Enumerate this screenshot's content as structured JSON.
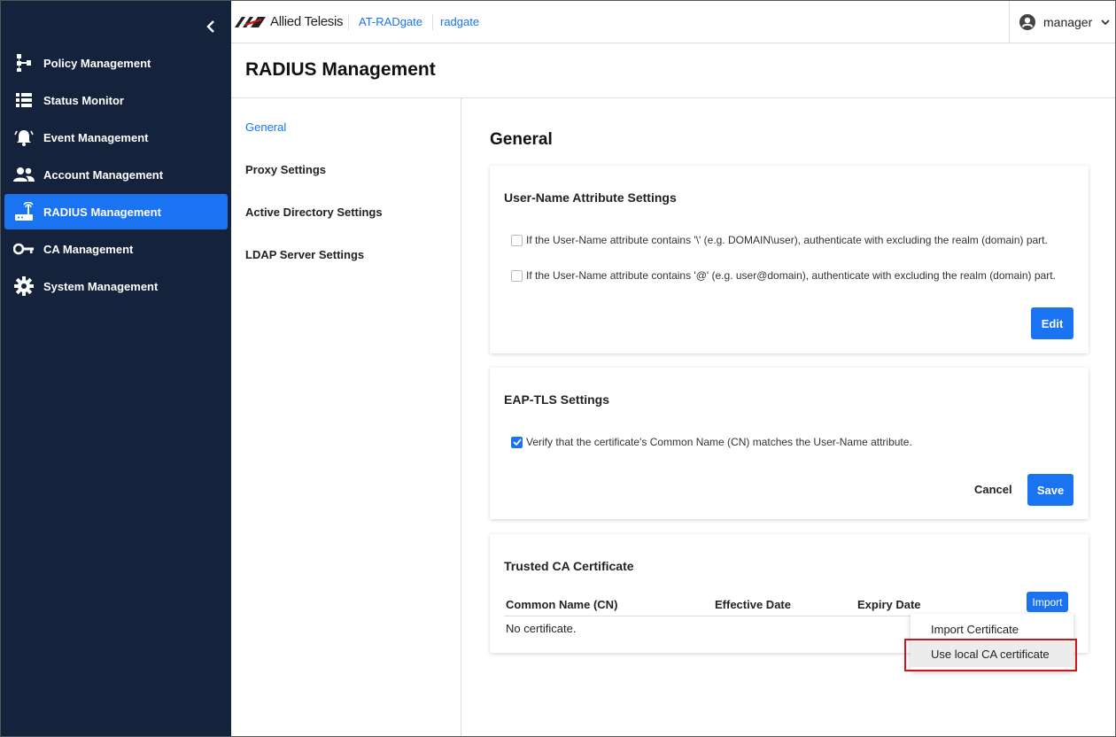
{
  "brand": {
    "name": "Allied Telesis"
  },
  "breadcrumb": [
    "AT-RADgate",
    "radgate"
  ],
  "user": {
    "name": "manager"
  },
  "sidebar": {
    "items": [
      {
        "label": "Policy Management",
        "icon": "policy-tree-icon"
      },
      {
        "label": "Status Monitor",
        "icon": "list-icon"
      },
      {
        "label": "Event Management",
        "icon": "alarm-bell-icon"
      },
      {
        "label": "Account Management",
        "icon": "people-icon"
      },
      {
        "label": "RADIUS Management",
        "icon": "router-icon"
      },
      {
        "label": "CA Management",
        "icon": "key-icon"
      },
      {
        "label": "System Management",
        "icon": "gear-icon"
      }
    ],
    "active": "RADIUS Management"
  },
  "page": {
    "title": "RADIUS Management"
  },
  "subnav": {
    "items": [
      "General",
      "Proxy Settings",
      "Active Directory Settings",
      "LDAP Server Settings"
    ],
    "active": "General"
  },
  "main": {
    "section_title": "General",
    "username_card": {
      "title": "User-Name Attribute Settings",
      "options": [
        {
          "label": "If the User-Name attribute contains '\\' (e.g. DOMAIN\\user), authenticate with excluding the realm (domain) part.",
          "checked": false
        },
        {
          "label": "If the User-Name attribute contains '@' (e.g. user@domain), authenticate with excluding the realm (domain) part.",
          "checked": false
        }
      ],
      "edit_label": "Edit"
    },
    "eaptls_card": {
      "title": "EAP-TLS Settings",
      "option": {
        "label": "Verify that the certificate's Common Name (CN) matches the User-Name attribute.",
        "checked": true
      },
      "cancel_label": "Cancel",
      "save_label": "Save"
    },
    "trusted_ca_card": {
      "title": "Trusted CA Certificate",
      "columns": [
        "Common Name (CN)",
        "Effective Date",
        "Expiry Date"
      ],
      "empty_text": "No certificate.",
      "import_label": "Import"
    }
  },
  "import_menu": {
    "items": [
      "Import Certificate",
      "Use local CA certificate"
    ],
    "hovered": "Use local CA certificate"
  },
  "colors": {
    "accent": "#1a73f0",
    "sidebar_bg": "#15223b",
    "highlight": "#d0141c"
  }
}
